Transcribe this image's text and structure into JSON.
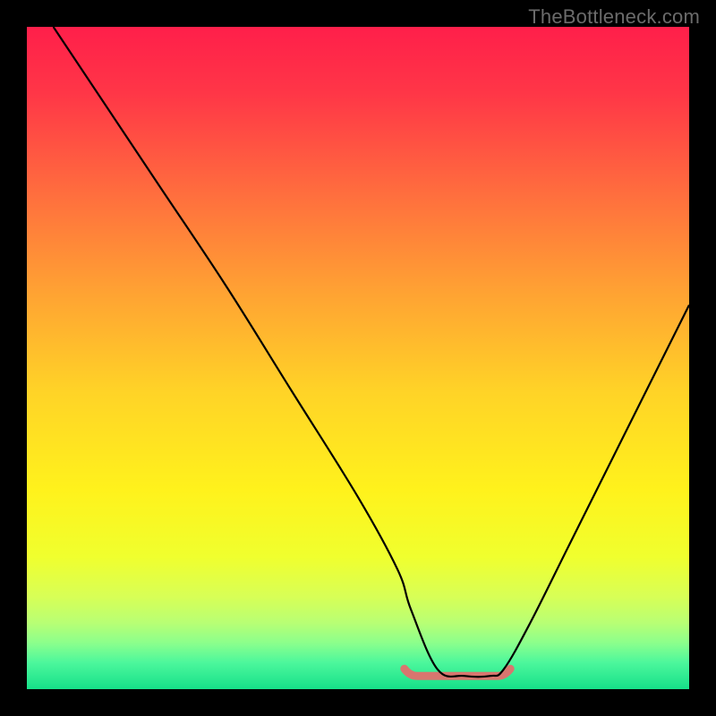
{
  "watermark": "TheBottleneck.com",
  "chart_data": {
    "type": "line",
    "title": "",
    "xlabel": "",
    "ylabel": "",
    "xlim": [
      0,
      100
    ],
    "ylim": [
      0,
      100
    ],
    "grid": false,
    "series": [
      {
        "name": "curve",
        "color": "#000000",
        "x": [
          4,
          10,
          20,
          30,
          40,
          50,
          56,
          58,
          62,
          66,
          70,
          72,
          76,
          82,
          90,
          100
        ],
        "y": [
          100,
          91,
          76,
          61,
          45,
          29,
          18,
          12,
          3,
          2,
          2,
          3,
          10,
          22,
          38,
          58
        ]
      }
    ],
    "optimal_band": {
      "color": "#d8766f",
      "x_start": 57,
      "x_end": 73,
      "y": 2
    },
    "gradient_stops": [
      {
        "offset": 0.0,
        "color": "#ff1f4a"
      },
      {
        "offset": 0.1,
        "color": "#ff3647"
      },
      {
        "offset": 0.25,
        "color": "#ff6d3e"
      },
      {
        "offset": 0.4,
        "color": "#ffa233"
      },
      {
        "offset": 0.55,
        "color": "#ffd327"
      },
      {
        "offset": 0.7,
        "color": "#fff21c"
      },
      {
        "offset": 0.8,
        "color": "#f0ff2e"
      },
      {
        "offset": 0.86,
        "color": "#d8ff56"
      },
      {
        "offset": 0.9,
        "color": "#b8ff74"
      },
      {
        "offset": 0.93,
        "color": "#8cff8c"
      },
      {
        "offset": 0.96,
        "color": "#4cf79c"
      },
      {
        "offset": 1.0,
        "color": "#16e089"
      }
    ]
  }
}
